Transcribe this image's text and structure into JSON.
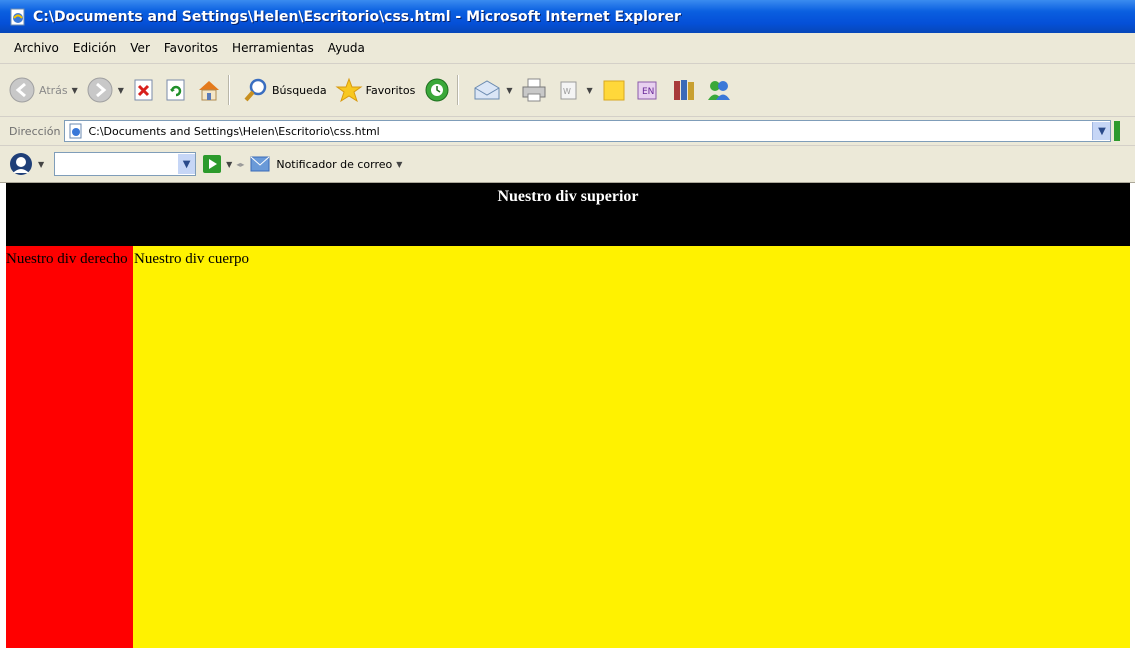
{
  "window": {
    "title": "C:\\Documents and Settings\\Helen\\Escritorio\\css.html - Microsoft Internet Explorer"
  },
  "menu": {
    "items": [
      "Archivo",
      "Edición",
      "Ver",
      "Favoritos",
      "Herramientas",
      "Ayuda"
    ]
  },
  "toolbar": {
    "back_label": "Atrás",
    "search_label": "Búsqueda",
    "favorites_label": "Favoritos"
  },
  "address": {
    "label": "Dirección",
    "value": "C:\\Documents and Settings\\Helen\\Escritorio\\css.html"
  },
  "links_bar": {
    "mail_notifier_label": "Notificador de correo"
  },
  "page": {
    "div_superior": "Nuestro div superior",
    "div_derecho": "Nuestro div derecho",
    "div_cuerpo": "Nuestro div cuerpo"
  },
  "colors": {
    "title_bar": "#0550d8",
    "chrome": "#ece9d8",
    "div_superior_bg": "#000000",
    "div_derecho_bg": "#ff0000",
    "div_cuerpo_bg": "#fff200"
  }
}
